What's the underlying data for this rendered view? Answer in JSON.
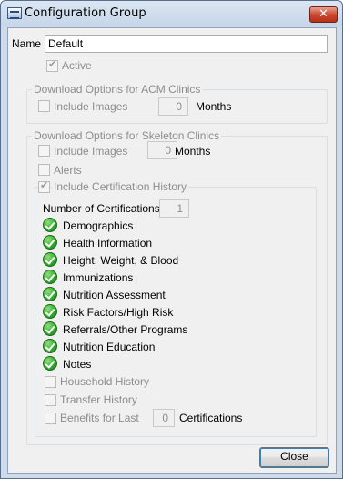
{
  "window": {
    "title": "Configuration Group",
    "close_glyph": "✕"
  },
  "name_field": {
    "label": "Name",
    "value": "Default"
  },
  "active": {
    "label": "Active",
    "checked": true
  },
  "acm_group": {
    "title": "Download Options for ACM Clinics",
    "include_images_label": "Include Images",
    "months_value": "0",
    "months_label": "Months"
  },
  "skeleton_group": {
    "title": "Download Options for Skeleton Clinics",
    "include_images_label": "Include Images",
    "months_value": "0",
    "months_label": "Months",
    "alerts_label": "Alerts",
    "cert_history_label": "Include Certification History",
    "num_cert_label": "Number of Certifications",
    "num_cert_value": "1",
    "sections": [
      "Demographics",
      "Health Information",
      "Height, Weight, & Blood",
      "Immunizations",
      "Nutrition Assessment",
      "Risk Factors/High Risk",
      "Referrals/Other Programs",
      "Nutrition Education",
      "Notes"
    ],
    "household_history_label": "Household History",
    "transfer_history_label": "Transfer History",
    "benefits_label": "Benefits for Last",
    "benefits_value": "0",
    "certifications_label": "Certifications"
  },
  "buttons": {
    "close_label": "Close"
  },
  "icons": {
    "section_status": "green-check-icon",
    "app": "app-window-icon"
  }
}
